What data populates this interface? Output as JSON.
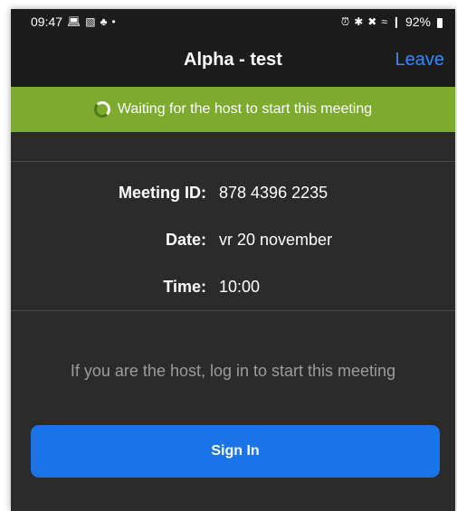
{
  "status_bar": {
    "time": "09:47",
    "battery": "92%",
    "left_icons": [
      "laptop-icon",
      "image-icon",
      "snapchat-icon",
      "dot-icon"
    ],
    "right_icons": [
      "alarm-icon",
      "bluetooth-icon",
      "mute-icon",
      "wifi-icon",
      "signal-icon",
      "battery-icon"
    ]
  },
  "header": {
    "title": "Alpha - test",
    "leave_label": "Leave"
  },
  "banner": {
    "text": "Waiting for the host to start this meeting",
    "color": "#7dab2e"
  },
  "details": {
    "meeting_id_label": "Meeting ID:",
    "meeting_id_value": "878 4396 2235",
    "date_label": "Date:",
    "date_value": "vr 20 november",
    "time_label": "Time:",
    "time_value": "10:00"
  },
  "host_message": "If you are the host, log in to start this meeting",
  "signin_label": "Sign In",
  "colors": {
    "accent": "#1a74e8",
    "link": "#2e8bff",
    "background": "#2b2b2b"
  }
}
